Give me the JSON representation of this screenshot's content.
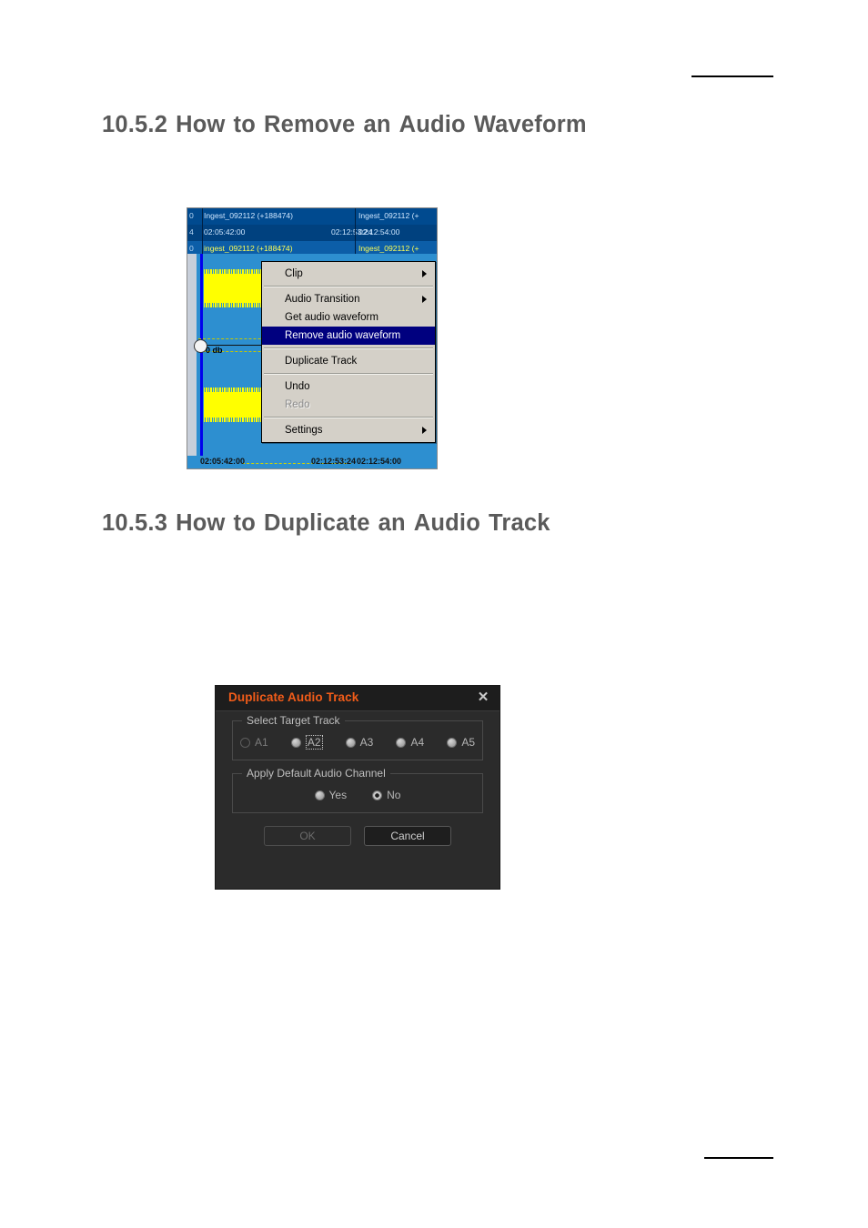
{
  "page": {
    "rules": [
      "top-rule",
      "bottom-rule"
    ]
  },
  "headings": {
    "h1052": {
      "number": "10.5.2",
      "words": [
        "How",
        "to",
        "Remove",
        "an",
        "Audio",
        "Waveform"
      ]
    },
    "h1053": {
      "number": "10.5.3",
      "words": [
        "How",
        "to",
        "Duplicate",
        "an",
        "Audio",
        "Track"
      ]
    }
  },
  "timeline": {
    "strip_title": {
      "gutter": "0",
      "clip_left": "Ingest_092112 (+188474)",
      "clip_right": "Ingest_092112 (+"
    },
    "strip_times": {
      "gutter": "4",
      "tc_in": "02:05:42:00",
      "tc_out": "02:12:53:24",
      "tc_next": "02:12:54:00"
    },
    "strip_sub": {
      "gutter": "0",
      "clip_left": "ingest_092112 (+188474)",
      "clip_right": "Ingest_092112 (+"
    },
    "gain_label": "0 db",
    "footer": {
      "tc_in": "02:05:42:00",
      "tc_out": "02:12:53:24",
      "tc_next": "02:12:54:00"
    },
    "colors": {
      "clip_blue": "#2d8fd0",
      "waveform_yellow": "#ffff00",
      "header_navy": "#004a8f",
      "playhead_blue": "#0000ee"
    }
  },
  "context_menu": {
    "items": [
      {
        "label": "Clip",
        "submenu": true,
        "state": "normal"
      },
      {
        "separator": true
      },
      {
        "label": "Audio Transition",
        "submenu": true,
        "state": "normal"
      },
      {
        "label": "Get audio waveform",
        "submenu": false,
        "state": "normal"
      },
      {
        "label": "Remove audio waveform",
        "submenu": false,
        "state": "highlighted"
      },
      {
        "separator": true
      },
      {
        "label": "Duplicate Track",
        "submenu": false,
        "state": "normal"
      },
      {
        "separator": true
      },
      {
        "label": "Undo",
        "submenu": false,
        "state": "normal"
      },
      {
        "label": "Redo",
        "submenu": false,
        "state": "disabled"
      },
      {
        "separator": true
      },
      {
        "label": "Settings",
        "submenu": true,
        "state": "normal"
      }
    ],
    "highlight_color": "#00007f",
    "background_color": "#d4d0c8"
  },
  "dialog": {
    "title": "Duplicate Audio Track",
    "title_color": "#f25c19",
    "close_icon": "✕",
    "group_target": {
      "legend": "Select Target Track",
      "options": [
        {
          "label": "A1",
          "state": "disabled"
        },
        {
          "label": "A2",
          "state": "focused"
        },
        {
          "label": "A3",
          "state": "normal"
        },
        {
          "label": "A4",
          "state": "normal"
        },
        {
          "label": "A5",
          "state": "normal"
        }
      ]
    },
    "group_channel": {
      "legend": "Apply Default Audio Channel",
      "options": [
        {
          "label": "Yes",
          "state": "normal"
        },
        {
          "label": "No",
          "state": "selected"
        }
      ]
    },
    "buttons": {
      "ok": "OK",
      "cancel": "Cancel"
    }
  }
}
